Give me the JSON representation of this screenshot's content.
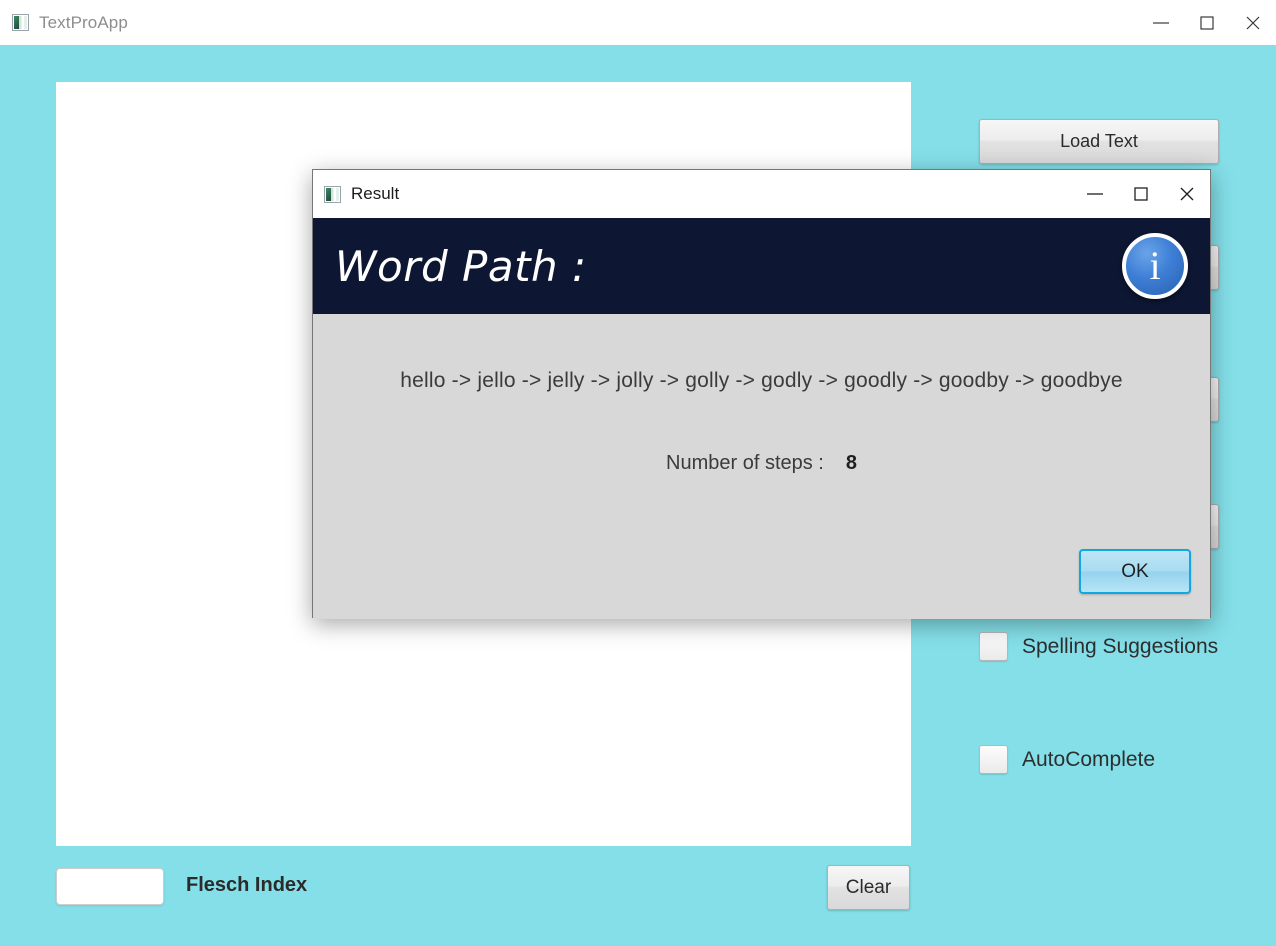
{
  "window": {
    "title": "TextProApp",
    "icon": "app-icon",
    "controls": {
      "minimize": "minimize-icon",
      "maximize": "maximize-icon",
      "close": "close-icon"
    }
  },
  "main": {
    "text_area": {
      "value": "",
      "placeholder": ""
    },
    "load_text_label": "Load Text",
    "hidden_buttons": [
      {
        "label": ""
      },
      {
        "label": ""
      },
      {
        "label": ""
      }
    ],
    "checkboxes": [
      {
        "label": "Spelling Suggestions",
        "checked": false
      },
      {
        "label": "AutoComplete",
        "checked": false
      }
    ],
    "flesch": {
      "value": "",
      "placeholder": "",
      "label": "Flesch Index"
    },
    "clear_label": "Clear"
  },
  "dialog": {
    "title": "Result",
    "icon": "app-icon",
    "controls": {
      "minimize": "minimize-icon",
      "maximize": "maximize-icon",
      "close": "close-icon"
    },
    "banner": {
      "heading": "Word Path :",
      "icon": "info-icon",
      "icon_glyph": "i",
      "background": "#0d1733"
    },
    "body": {
      "path_text": "hello -> jello -> jelly -> jolly -> golly -> godly -> goodly -> goodby -> goodbye",
      "steps_label": "Number of steps :",
      "steps_value": "8"
    },
    "ok_label": "OK"
  },
  "colors": {
    "page_background": "#84dfe8",
    "dialog_background": "#d8d8d8",
    "banner": "#0d1733",
    "accent_focus": "#11a7e0",
    "info_blue": "#3d7fd6"
  }
}
